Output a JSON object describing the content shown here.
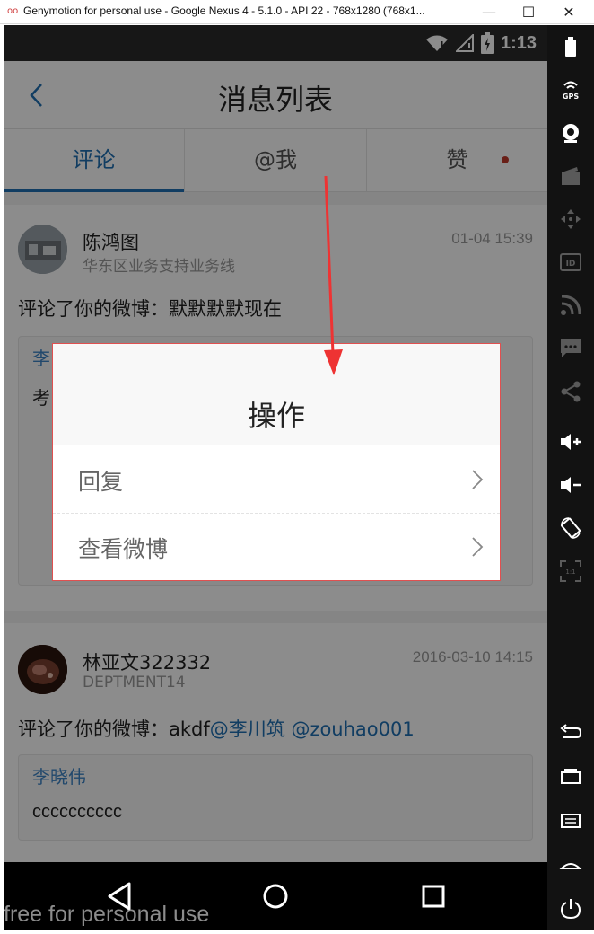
{
  "window": {
    "title": "Genymotion for personal use - Google Nexus 4 - 5.1.0 - API 22 - 768x1280 (768x1...",
    "logo": "oo",
    "minimize": "—",
    "maximize": "☐",
    "close": "✕"
  },
  "statusbar": {
    "time": "1:13",
    "icons": [
      "wifi-icon",
      "signal-icon",
      "battery-icon"
    ]
  },
  "header": {
    "title": "消息列表",
    "back_icon": "chevron-left-icon"
  },
  "tabs": [
    {
      "label": "评论",
      "active": true
    },
    {
      "label": "@我",
      "active": false
    },
    {
      "label": "赞",
      "active": false,
      "has_dot": true
    }
  ],
  "messages": [
    {
      "name": "陈鸿图",
      "dept": "华东区业务支持业务线",
      "time": "01-04 15:39",
      "content": "评论了你的微博：默默默默现在",
      "quote_author": "李",
      "quote_text": "考"
    },
    {
      "name": "林亚文322332",
      "dept": "DEPTMENT14",
      "time": "2016-03-10 14:15",
      "content_prefix": "评论了你的微博：akdf",
      "mentions": [
        "@李川筑",
        " @zouhao001"
      ],
      "quote_author": "李晓伟",
      "quote_text": "cccccccccc"
    }
  ],
  "dialog": {
    "title": "操作",
    "items": [
      "回复",
      "查看微博"
    ]
  },
  "navbar": {
    "buttons": [
      "back-triangle-icon",
      "home-circle-icon",
      "recents-square-icon"
    ]
  },
  "watermark": "free for personal use",
  "sidebar": {
    "items": [
      "battery-icon",
      "gps-icon",
      "webcam-icon",
      "capture-icon",
      "dpad-icon",
      "id-icon",
      "rss-icon",
      "sms-icon",
      "share-icon",
      "volume-up-icon",
      "volume-down-icon",
      "rotate-icon",
      "scale-icon",
      "back-icon",
      "recent-apps-icon",
      "menu-icon",
      "home-icon",
      "power-icon"
    ],
    "gps_label": "GPS",
    "id_label": "ID",
    "scale_label": "1:1"
  },
  "colors": {
    "accent": "#1f6fb2",
    "mention": "#3c83c5",
    "dot": "#c0392b",
    "arrow": "#ee3333"
  }
}
